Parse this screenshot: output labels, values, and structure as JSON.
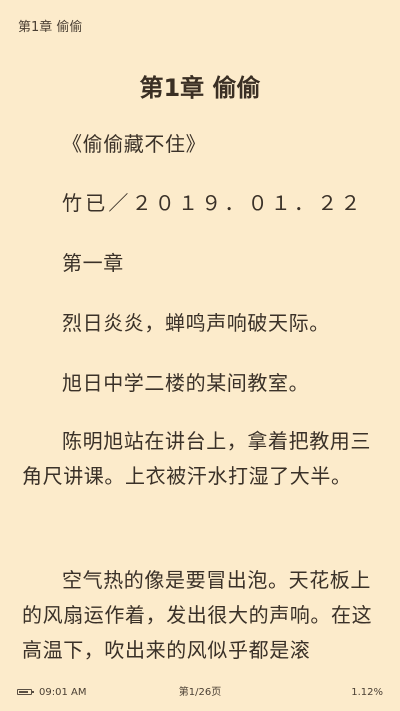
{
  "header": {
    "chapter_label": "第1章 偷偷"
  },
  "content": {
    "chapter_title": "第1章 偷偷",
    "paragraphs": [
      "《偷偷藏不住》",
      "竹已／２０１９．０１．２２",
      "第一章",
      "烈日炎炎，蝉鸣声响破天际。",
      "旭日中学二楼的某间教室。",
      "陈明旭站在讲台上，拿着把教用三角尺讲课。上衣被汗水打湿了大半。",
      "空气热的像是要冒出泡。天花板上的风扇运作着，发出很大的声响。在这高温下，吹出来的风似乎都是滚"
    ]
  },
  "footer": {
    "battery_level": 0.8,
    "time": "09:01 AM",
    "page": "第1/26页",
    "progress": "1.12%"
  },
  "colors": {
    "background": "#fcebcb",
    "text": "#3a3128"
  }
}
